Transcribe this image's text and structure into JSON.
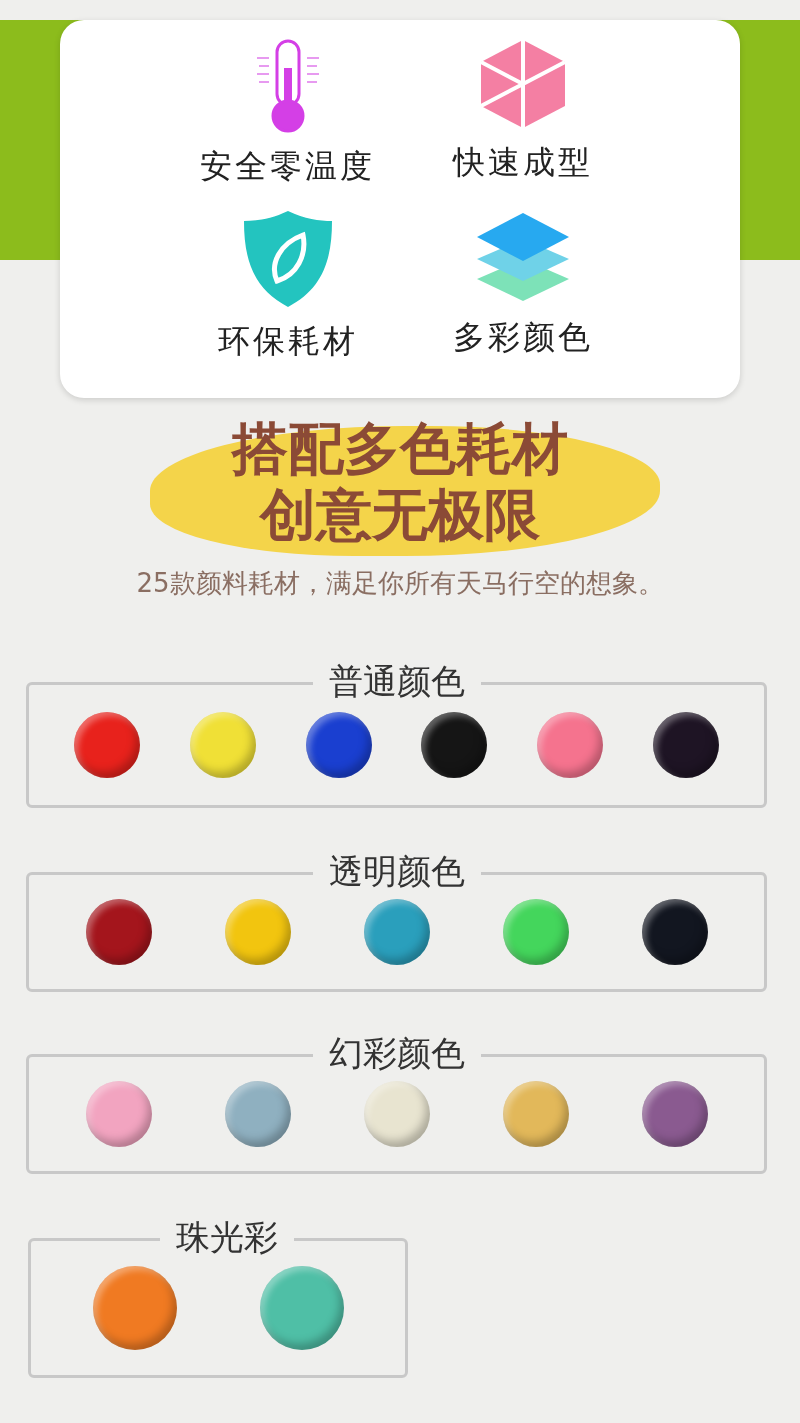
{
  "features": [
    {
      "kind": "thermometer",
      "label": "安全零温度"
    },
    {
      "kind": "cube",
      "label": "快速成型"
    },
    {
      "kind": "shield",
      "label": "环保耗材"
    },
    {
      "kind": "layers",
      "label": "多彩颜色"
    }
  ],
  "headline": {
    "lines": [
      "搭配多色耗材",
      "创意无极限"
    ],
    "subtitle": "25款颜料耗材，满足你所有天马行空的想象。"
  },
  "groups": [
    {
      "title": "普通颜色",
      "swatches": [
        {
          "color": "#e8221c"
        },
        {
          "color": "#f0e036"
        },
        {
          "color": "#1a3fd0"
        },
        {
          "color": "#151515"
        },
        {
          "color": "#f5738e"
        },
        {
          "color": "#1e1424"
        }
      ]
    },
    {
      "title": "透明颜色",
      "swatches": [
        {
          "color": "#a4151c"
        },
        {
          "color": "#f2c50f"
        },
        {
          "color": "#2a9fbc"
        },
        {
          "color": "#44d65c"
        },
        {
          "color": "#121620"
        }
      ]
    },
    {
      "title": "幻彩颜色",
      "swatches": [
        {
          "color": "#f2a4c0"
        },
        {
          "color": "#8fb0c0"
        },
        {
          "color": "#e8e4d0"
        },
        {
          "color": "#e2b85a"
        },
        {
          "color": "#8a5a90"
        }
      ]
    },
    {
      "title": "珠光彩",
      "swatches": [
        {
          "color": "#f07a22"
        },
        {
          "color": "#4fbfa6"
        }
      ]
    }
  ]
}
